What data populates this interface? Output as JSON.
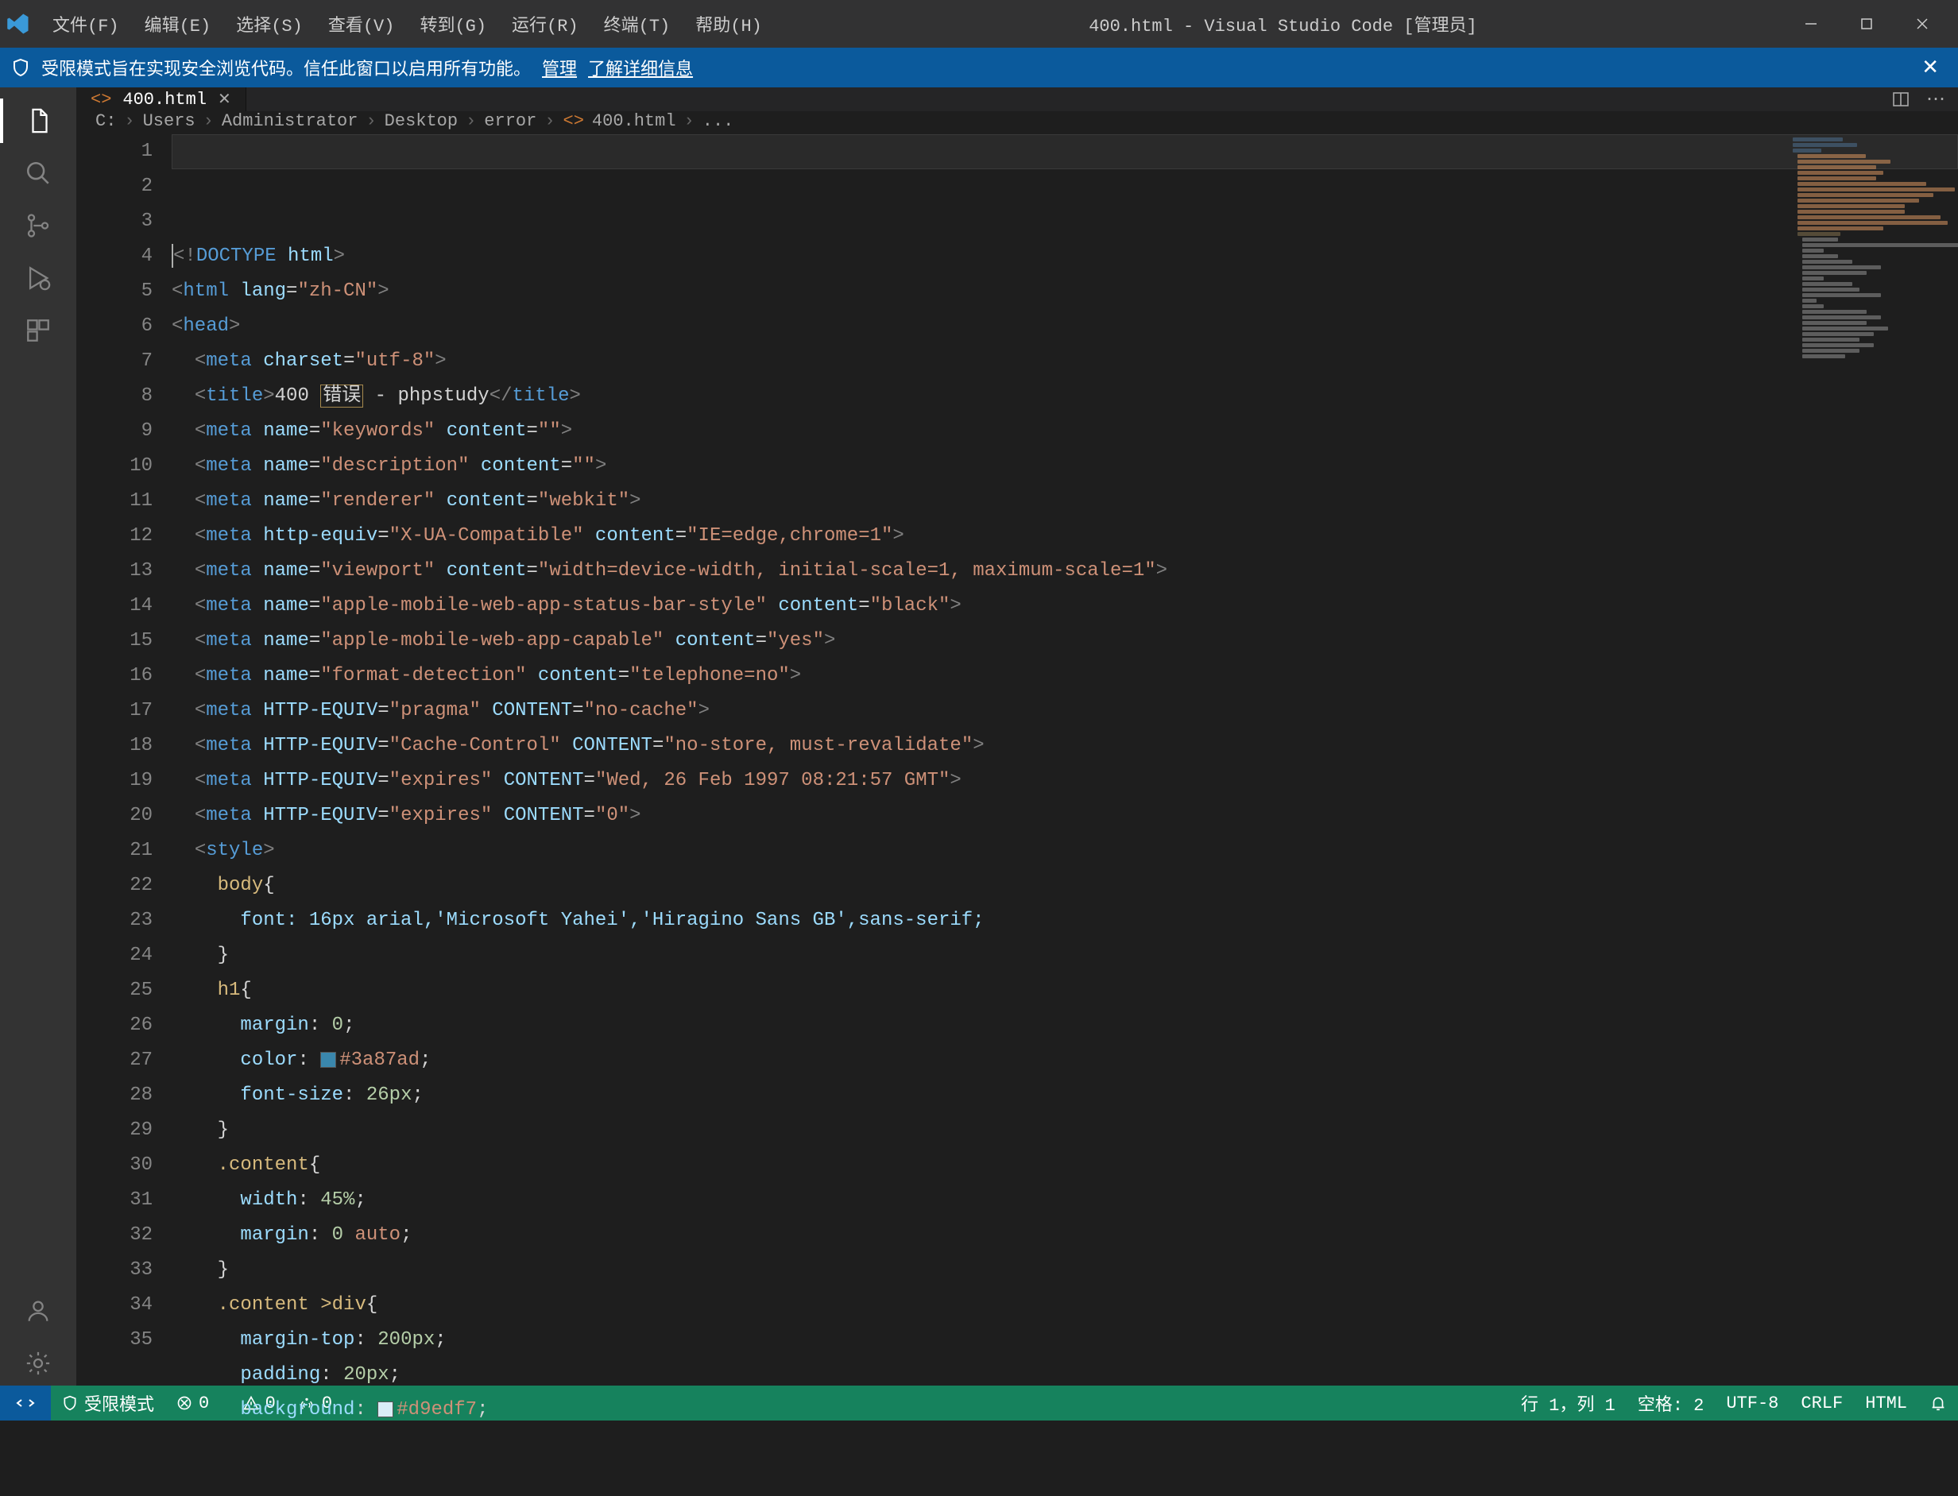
{
  "titlebar": {
    "menus": [
      "文件(F)",
      "编辑(E)",
      "选择(S)",
      "查看(V)",
      "转到(G)",
      "运行(R)",
      "终端(T)",
      "帮助(H)"
    ],
    "title": "400.html - Visual Studio Code [管理员]"
  },
  "infobar": {
    "text": "受限模式旨在实现安全浏览代码。信任此窗口以启用所有功能。",
    "manage": "管理",
    "learn": "了解详细信息"
  },
  "tab": {
    "label": "400.html"
  },
  "breadcrumb": {
    "parts": [
      "C:",
      "Users",
      "Administrator",
      "Desktop",
      "error",
      "400.html",
      "..."
    ],
    "fileIndex": 5
  },
  "lineNumbers": [
    "1",
    "2",
    "3",
    "4",
    "5",
    "6",
    "7",
    "8",
    "9",
    "10",
    "11",
    "12",
    "13",
    "14",
    "15",
    "16",
    "17",
    "18",
    "19",
    "20",
    "21",
    "22",
    "23",
    "24",
    "25",
    "26",
    "27",
    "28",
    "29",
    "30",
    "31",
    "32",
    "33",
    "34",
    "35"
  ],
  "statusbar": {
    "mode": "受限模式",
    "errors0": "0",
    "warnings0": "0",
    "radio0": "0",
    "pos": "行 1，列 1",
    "spaces": "空格: 2",
    "encoding": "UTF-8",
    "eol": "CRLF",
    "lang": "HTML"
  },
  "code": {
    "colors": {
      "h1": "#3a87ad",
      "bg": "#d9edf7"
    },
    "title_text_1": "400 ",
    "title_text_boxed": "错误",
    "title_text_2": " - phpstudy",
    "meta_ie": "IE=edge,chrome=1",
    "meta_viewport": "width=device-width, initial-scale=1, maximum-scale=1",
    "meta_expires": "Wed, 26 Feb 1997 08:21:57 GMT",
    "font": "font: 16px arial,'Microsoft Yahei','Hiragino Sans GB',sans-serif;",
    "h1_fs": "26px",
    "content_w": "45%",
    "mt": "200px",
    "pad": "20px"
  }
}
